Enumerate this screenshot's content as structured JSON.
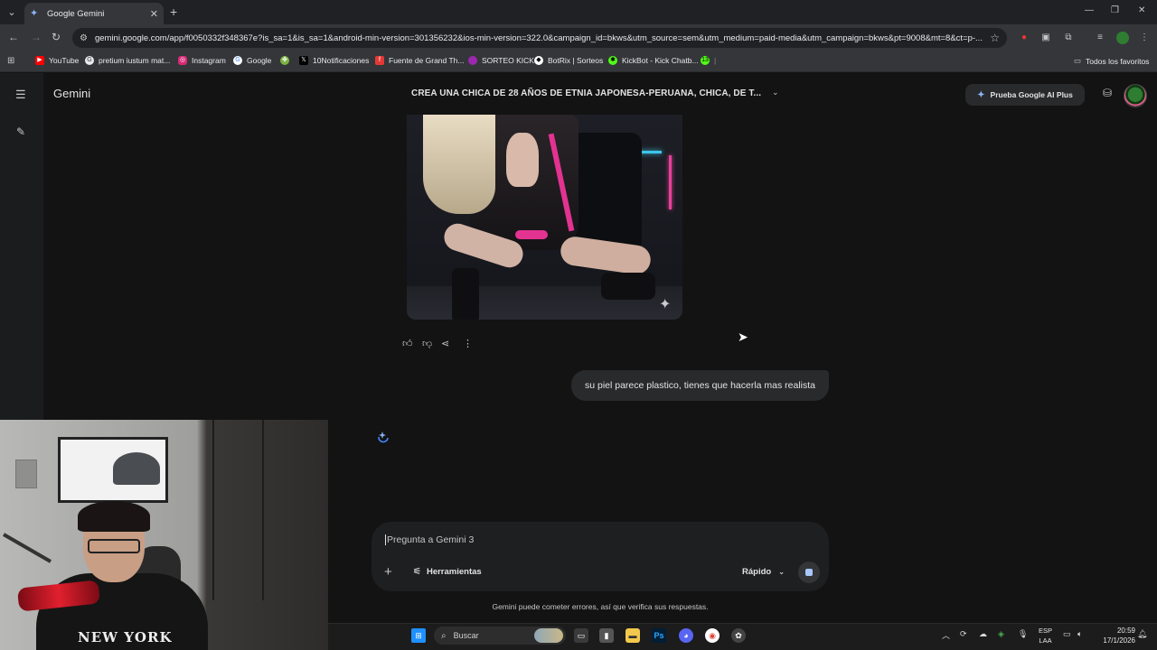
{
  "browser": {
    "tab_title": "Google Gemini",
    "url": "gemini.google.com/app/f0050332f348367e?is_sa=1&is_sa=1&android-min-version=301356232&ios-min-version=322.0&campaign_id=bkws&utm_source=sem&utm_medium=paid-media&utm_campaign=bkws&pt=9008&mt=8&ct=p-...",
    "bookmarks": [
      {
        "label": "YouTube",
        "color": "#ff0000"
      },
      {
        "label": "pretium iustum mat...",
        "color": "#e8eaed"
      },
      {
        "label": "Instagram",
        "color": "#d62976"
      },
      {
        "label": "Google",
        "color": "#4285f4"
      },
      {
        "label": "",
        "color": "#7cb342"
      },
      {
        "label": "10Notificaciones",
        "color": "#000000"
      },
      {
        "label": "Fuente de Grand Th...",
        "color": "#e53935"
      },
      {
        "label": "SORTEO KICK",
        "color": "#9c27b0"
      },
      {
        "label": "BotRix | Sorteos",
        "color": "#ffffff"
      },
      {
        "label": "KickBot - Kick Chatb...",
        "color": "#53fc18"
      },
      {
        "label": "13",
        "color": "#53fc18"
      }
    ],
    "all_bookmarks": "Todos los favoritos"
  },
  "gemini": {
    "brand": "Gemini",
    "chat_title": "CREA UNA CHICA DE 28 AÑOS DE ETNIA JAPONESA-PERUANA, CHICA, DE T...",
    "upgrade_button": "Prueba Google AI Plus",
    "user_message": "su piel parece plastico, tienes que hacerla mas realista",
    "prompt_placeholder": "Pregunta a Gemini 3",
    "tools_label": "Herramientas",
    "mode_label": "Rápido",
    "disclaimer": "Gemini puede cometer errores, así que verifica sus respuestas.",
    "accent_color": "#8ab4f8"
  },
  "taskbar": {
    "search_label": "Buscar",
    "language_line1": "ESP",
    "language_line2": "LAA",
    "time": "20:59",
    "date": "17/1/2026"
  },
  "webcam": {
    "hoodie_text": "NEW YORK"
  }
}
